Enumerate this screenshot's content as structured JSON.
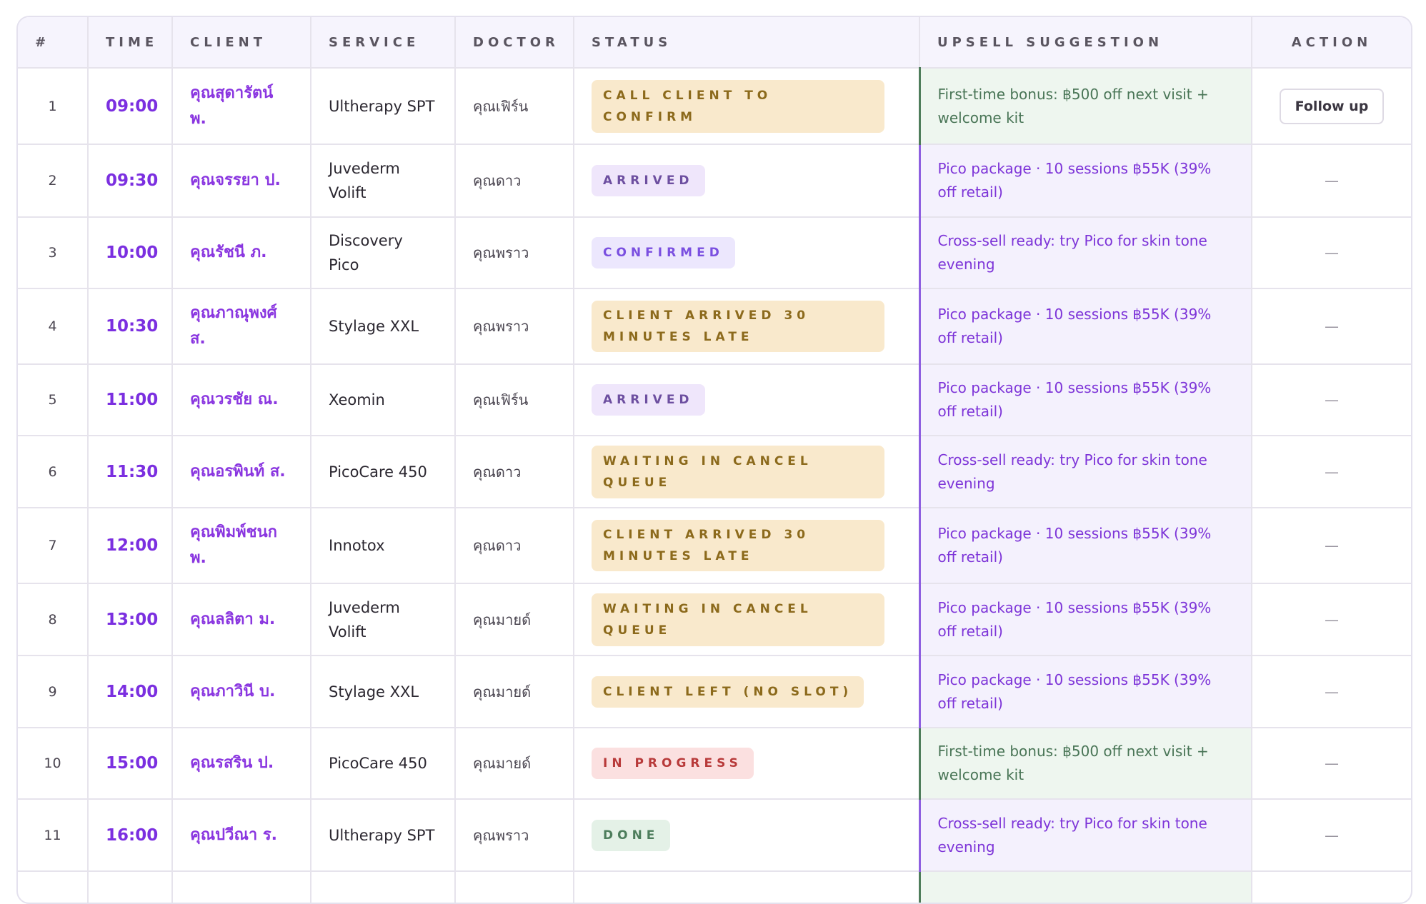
{
  "headers": {
    "num": "#",
    "time": "TIME",
    "client": "CLIENT",
    "service": "SERVICE",
    "doctor": "DOCTOR",
    "status": "STATUS",
    "upsell": "UPSELL SUGGESTION",
    "action": "ACTION"
  },
  "colors": {
    "accent_purple": "#7b2fe0",
    "status_amber_bg": "#f9e9cc",
    "status_amber_text": "#8c6a1c",
    "status_red_bg": "#fbe0e0",
    "status_green_bg": "#e4f1e7",
    "upsell_purple_bg": "#f4f1fd",
    "upsell_green_bg": "#eef6ef"
  },
  "rows": [
    {
      "num": "1",
      "time": "09:00",
      "client": "คุณสุดารัตน์ พ.",
      "service": "Ultherapy SPT",
      "doctor": "คุณเฟิร์น",
      "status": "CALL CLIENT TO CONFIRM",
      "status_style": "amber",
      "upsell": "First-time bonus: ฿500 off next visit + welcome kit",
      "upsell_style": "green",
      "action": "Follow up"
    },
    {
      "num": "2",
      "time": "09:30",
      "client": "คุณจรรยา ป.",
      "service": "Juvederm Volift",
      "doctor": "คุณดาว",
      "status": "ARRIVED",
      "status_style": "lilac",
      "upsell": "Pico package · 10 sessions ฿55K (39% off retail)",
      "upsell_style": "purple",
      "action": "—"
    },
    {
      "num": "3",
      "time": "10:00",
      "client": "คุณรัชนี ภ.",
      "service": "Discovery Pico",
      "doctor": "คุณพราว",
      "status": "CONFIRMED",
      "status_style": "blue",
      "upsell": "Cross-sell ready: try Pico for skin tone evening",
      "upsell_style": "purple",
      "action": "—"
    },
    {
      "num": "4",
      "time": "10:30",
      "client": "คุณภาณุพงศ์ ส.",
      "service": "Stylage XXL",
      "doctor": "คุณพราว",
      "status": "CLIENT ARRIVED 30 MINUTES LATE",
      "status_style": "amber",
      "upsell": "Pico package · 10 sessions ฿55K (39% off retail)",
      "upsell_style": "purple",
      "action": "—"
    },
    {
      "num": "5",
      "time": "11:00",
      "client": "คุณวรชัย ณ.",
      "service": "Xeomin",
      "doctor": "คุณเฟิร์น",
      "status": "ARRIVED",
      "status_style": "lilac",
      "upsell": "Pico package · 10 sessions ฿55K (39% off retail)",
      "upsell_style": "purple",
      "action": "—"
    },
    {
      "num": "6",
      "time": "11:30",
      "client": "คุณอรพินท์ ส.",
      "service": "PicoCare 450",
      "doctor": "คุณดาว",
      "status": "WAITING IN CANCEL QUEUE",
      "status_style": "amber",
      "upsell": "Cross-sell ready: try Pico for skin tone evening",
      "upsell_style": "purple",
      "action": "—"
    },
    {
      "num": "7",
      "time": "12:00",
      "client": "คุณพิมพ์ชนก พ.",
      "service": "Innotox",
      "doctor": "คุณดาว",
      "status": "CLIENT ARRIVED 30 MINUTES LATE",
      "status_style": "amber",
      "upsell": "Pico package · 10 sessions ฿55K (39% off retail)",
      "upsell_style": "purple",
      "action": "—"
    },
    {
      "num": "8",
      "time": "13:00",
      "client": "คุณลลิตา ม.",
      "service": "Juvederm Volift",
      "doctor": "คุณมายด์",
      "status": "WAITING IN CANCEL QUEUE",
      "status_style": "amber",
      "upsell": "Pico package · 10 sessions ฿55K (39% off retail)",
      "upsell_style": "purple",
      "action": "—"
    },
    {
      "num": "9",
      "time": "14:00",
      "client": "คุณภาวินี บ.",
      "service": "Stylage XXL",
      "doctor": "คุณมายด์",
      "status": "CLIENT LEFT (NO SLOT)",
      "status_style": "amber",
      "upsell": "Pico package · 10 sessions ฿55K (39% off retail)",
      "upsell_style": "purple",
      "action": "—"
    },
    {
      "num": "10",
      "time": "15:00",
      "client": "คุณรสริน ป.",
      "service": "PicoCare 450",
      "doctor": "คุณมายด์",
      "status": "IN PROGRESS",
      "status_style": "red",
      "upsell": "First-time bonus: ฿500 off next visit + welcome kit",
      "upsell_style": "green",
      "action": "—"
    },
    {
      "num": "11",
      "time": "16:00",
      "client": "คุณปวีณา ร.",
      "service": "Ultherapy SPT",
      "doctor": "คุณพราว",
      "status": "DONE",
      "status_style": "green",
      "upsell": "Cross-sell ready: try Pico for skin tone evening",
      "upsell_style": "purple",
      "action": "—"
    }
  ]
}
